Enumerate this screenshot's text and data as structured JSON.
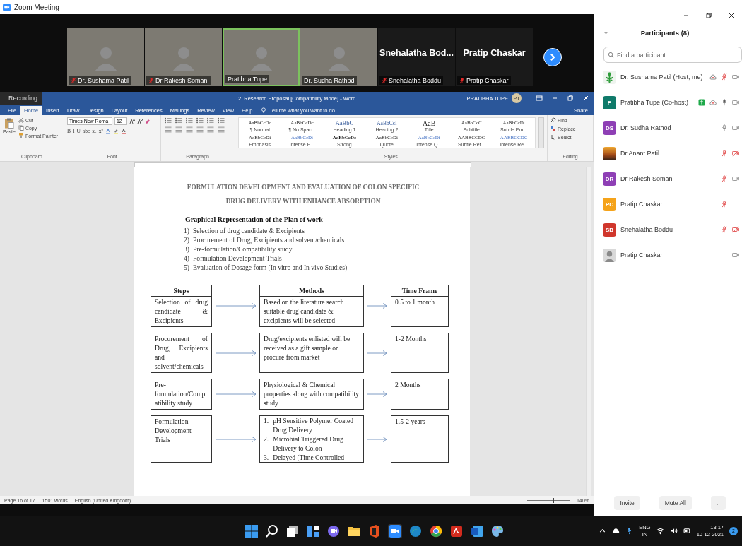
{
  "window": {
    "title": "Zoom Meeting"
  },
  "videos": [
    {
      "kind": "video",
      "name": "Dr. Sushama Patil",
      "muted": true,
      "speaking": false
    },
    {
      "kind": "video",
      "name": "Dr Rakesh Somani",
      "muted": true,
      "speaking": false
    },
    {
      "kind": "video",
      "name": "Pratibha Tupe",
      "muted": false,
      "speaking": true
    },
    {
      "kind": "video",
      "name": "Dr. Sudha Rathod",
      "muted": false,
      "speaking": false
    },
    {
      "kind": "name",
      "big_name": "Snehalatha Bod...",
      "name": "Snehalatha Boddu",
      "muted": true,
      "speaking": false
    },
    {
      "kind": "name",
      "big_name": "Pratip Chaskar",
      "name": "Pratip Chaskar",
      "muted": true,
      "speaking": false
    }
  ],
  "recording": {
    "label": "Recording..."
  },
  "word": {
    "title": "2. Research Proposal [Compatibility Mode] - Word",
    "user": "PRATIBHA TUPE",
    "user_initials": "PT",
    "share": "Share",
    "tell_me": "Tell me what you want to do",
    "tabs": [
      {
        "label": "File",
        "selected": false
      },
      {
        "label": "Home",
        "selected": true
      },
      {
        "label": "Insert",
        "selected": false
      },
      {
        "label": "Draw",
        "selected": false
      },
      {
        "label": "Design",
        "selected": false
      },
      {
        "label": "Layout",
        "selected": false
      },
      {
        "label": "References",
        "selected": false
      },
      {
        "label": "Mailings",
        "selected": false
      },
      {
        "label": "Review",
        "selected": false
      },
      {
        "label": "View",
        "selected": false
      },
      {
        "label": "Help",
        "selected": false
      }
    ],
    "ribbon": {
      "clipboard": {
        "paste": "Paste",
        "cut": "Cut",
        "copy": "Copy",
        "format_painter": "Format Painter",
        "label": "Clipboard"
      },
      "font": {
        "family": "Times New Roma",
        "size": "12",
        "format_buttons": [
          "B",
          "I",
          "U",
          "abc",
          "x₂",
          "x²"
        ],
        "label": "Font"
      },
      "paragraph": {
        "label": "Paragraph"
      },
      "styles": {
        "label": "Styles",
        "items": [
          {
            "sample": "AaBbCcDc",
            "name": "¶ Normal",
            "kind": "plain"
          },
          {
            "sample": "AaBbCcDc",
            "name": "¶ No Spac...",
            "kind": "plain"
          },
          {
            "sample": "AaBbC",
            "name": "Heading 1",
            "kind": "heading1"
          },
          {
            "sample": "AaBbCcI",
            "name": "Heading 2",
            "kind": "heading2"
          },
          {
            "sample": "AaB",
            "name": "Title",
            "kind": "title"
          },
          {
            "sample": "AaBbCcC",
            "name": "Subtitle",
            "kind": "plain"
          },
          {
            "sample": "AaBbCcDi",
            "name": "Subtle Em...",
            "kind": "plain"
          },
          {
            "sample": "AaBbCcDi",
            "name": "Emphasis",
            "kind": "plain"
          },
          {
            "sample": "AaBbCcDi",
            "name": "Intense E...",
            "kind": "accent"
          },
          {
            "sample": "AaBbCcDc",
            "name": "Strong",
            "kind": "bold"
          },
          {
            "sample": "AaBbCcDi",
            "name": "Quote",
            "kind": "plain"
          },
          {
            "sample": "AaBbCcDi",
            "name": "Intense Q...",
            "kind": "accent"
          },
          {
            "sample": "AABBCCDC",
            "name": "Subtle Ref...",
            "kind": "plain"
          },
          {
            "sample": "AABBCCDC",
            "name": "Intense Re...",
            "kind": "accent"
          }
        ]
      },
      "editing": {
        "find": "Find",
        "replace": "Replace",
        "select": "Select",
        "label": "Editing"
      }
    },
    "document": {
      "title_lines": [
        "FORMULATION DEVELOPMENT AND EVALUATION OF COLON SPECIFIC",
        "DRUG DELIVERY WITH ENHANCE ABSORPTION"
      ],
      "heading": "Graphical Representation of the Plan of work",
      "plan": [
        {
          "marker": "1)",
          "text": "Selection of drug candidate & Excipients"
        },
        {
          "marker": "2)",
          "text": "Procurement of Drug, Excipients and solvent/chemicals"
        },
        {
          "marker": "3)",
          "text": "Pre-formulation/Compatibility study"
        },
        {
          "marker": "4)",
          "text": "Formulation Development Trials"
        },
        {
          "marker": "5)",
          "text": "Evaluation of Dosage form (In vitro and In vivo Studies)"
        }
      ],
      "table": {
        "headers": [
          "Steps",
          "Methods",
          "Time Frame"
        ],
        "rows": [
          {
            "step": "Selection of drug candidate & Excipients",
            "kind": "text",
            "method": "Based on the literature search suitable drug candidate & excipients will be selected",
            "time": "0.5 to 1 month"
          },
          {
            "step": "Procurement of Drug, Excipients and solvent/chemicals",
            "kind": "text",
            "method": "Drug/excipients enlisted will be received as a gift sample or procure from market",
            "time": "1-2 Months"
          },
          {
            "step": "Pre-formulation/Compatibility study",
            "kind": "text",
            "method": "Physiological & Chemical properties along with compatibility study",
            "time": "2 Months"
          },
          {
            "step": "Formulation Development Trials",
            "kind": "list",
            "methods": [
              {
                "marker": "1.",
                "text": "pH Sensitive Polymer Coated Drug Delivery"
              },
              {
                "marker": "2.",
                "text": "Microbial Triggered Drug Delivery to Colon"
              },
              {
                "marker": "3.",
                "text": "Delayed (Time Controlled"
              }
            ],
            "time": "1.5-2 years"
          }
        ]
      }
    },
    "status_bar": {
      "page": "Page 16 of 17",
      "words": "1501 words",
      "language": "English (United Kingdom)",
      "zoom_slider": {
        "level": 0.6
      },
      "zoom": "140%"
    }
  },
  "participants": {
    "title": "Participants (8)",
    "search": {
      "placeholder": "Find a participant"
    },
    "items": [
      {
        "name": "Dr. Sushama Patil (Host, me)",
        "avatar": {
          "kind": "logo"
        },
        "badge": false,
        "recording": true,
        "mic": {
          "muted": true
        },
        "video": {
          "off": false
        }
      },
      {
        "name": "Pratibha Tupe (Co-host)",
        "avatar": {
          "kind": "initials",
          "initials": "P",
          "color": "#0f7a6a"
        },
        "badge": true,
        "recording": true,
        "mic": {
          "muted": false,
          "speaking": true
        },
        "video": {
          "off": false
        }
      },
      {
        "name": "Dr. Sudha Rathod",
        "avatar": {
          "kind": "initials",
          "initials": "DS",
          "color": "#8e3fb5"
        },
        "badge": false,
        "recording": false,
        "mic": {
          "muted": false,
          "speaking": false
        },
        "video": {
          "off": false
        }
      },
      {
        "name": "Dr Anant Patil",
        "avatar": {
          "kind": "photo"
        },
        "badge": false,
        "recording": false,
        "mic": {
          "muted": true
        },
        "video": {
          "off": true
        }
      },
      {
        "name": "Dr Rakesh Somani",
        "avatar": {
          "kind": "initials",
          "initials": "DR",
          "color": "#8e3fb5"
        },
        "badge": false,
        "recording": false,
        "mic": {
          "muted": true
        },
        "video": {
          "off": false
        }
      },
      {
        "name": "Pratip Chaskar",
        "avatar": {
          "kind": "initials",
          "initials": "PC",
          "color": "#f5a31a"
        },
        "badge": false,
        "recording": false,
        "mic": {
          "muted": true
        }
      },
      {
        "name": "Snehalatha Boddu",
        "avatar": {
          "kind": "initials",
          "initials": "SB",
          "color": "#d0362c"
        },
        "badge": false,
        "recording": false,
        "mic": {
          "muted": true
        },
        "video": {
          "off": true
        }
      },
      {
        "name": "Pratip Chaskar",
        "avatar": {
          "kind": "person"
        },
        "badge": false,
        "recording": false,
        "video": {
          "off": false
        }
      }
    ],
    "buttons": [
      "Invite",
      "Mute All",
      ".."
    ]
  },
  "taskbar": {
    "language": "ENG",
    "region": "IN",
    "time": "13:17",
    "date": "10-12-2021",
    "notifications": "2"
  }
}
